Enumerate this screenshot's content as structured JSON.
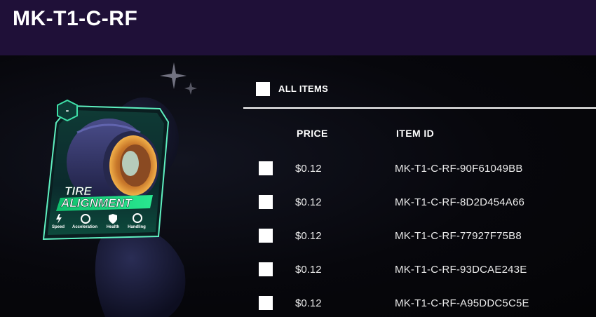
{
  "header": {
    "title": "MK-T1-C-RF"
  },
  "card": {
    "badge": "-",
    "title_line1": "TIRE",
    "title_line2": "ALIGNMENT",
    "stats": [
      {
        "icon": "lightning-icon",
        "label": "Speed"
      },
      {
        "icon": "speedometer-icon",
        "label": "Acceleration"
      },
      {
        "icon": "shield-icon",
        "label": "Health"
      },
      {
        "icon": "steering-wheel-icon",
        "label": "Handling"
      }
    ]
  },
  "list": {
    "all_items_label": "ALL ITEMS",
    "columns": {
      "price": "PRICE",
      "item_id": "ITEM ID"
    },
    "rows": [
      {
        "price": "$0.12",
        "item_id": "MK-T1-C-RF-90F61049BB"
      },
      {
        "price": "$0.12",
        "item_id": "MK-T1-C-RF-8D2D454A66"
      },
      {
        "price": "$0.12",
        "item_id": "MK-T1-C-RF-77927F75B8"
      },
      {
        "price": "$0.12",
        "item_id": "MK-T1-C-RF-93DCAE243E"
      },
      {
        "price": "$0.12",
        "item_id": "MK-T1-C-RF-A95DDC5C5E"
      }
    ]
  },
  "colors": {
    "header_bg": "#1f1038",
    "card_green": "#1fcf86",
    "checkbox": "#ffffff"
  }
}
